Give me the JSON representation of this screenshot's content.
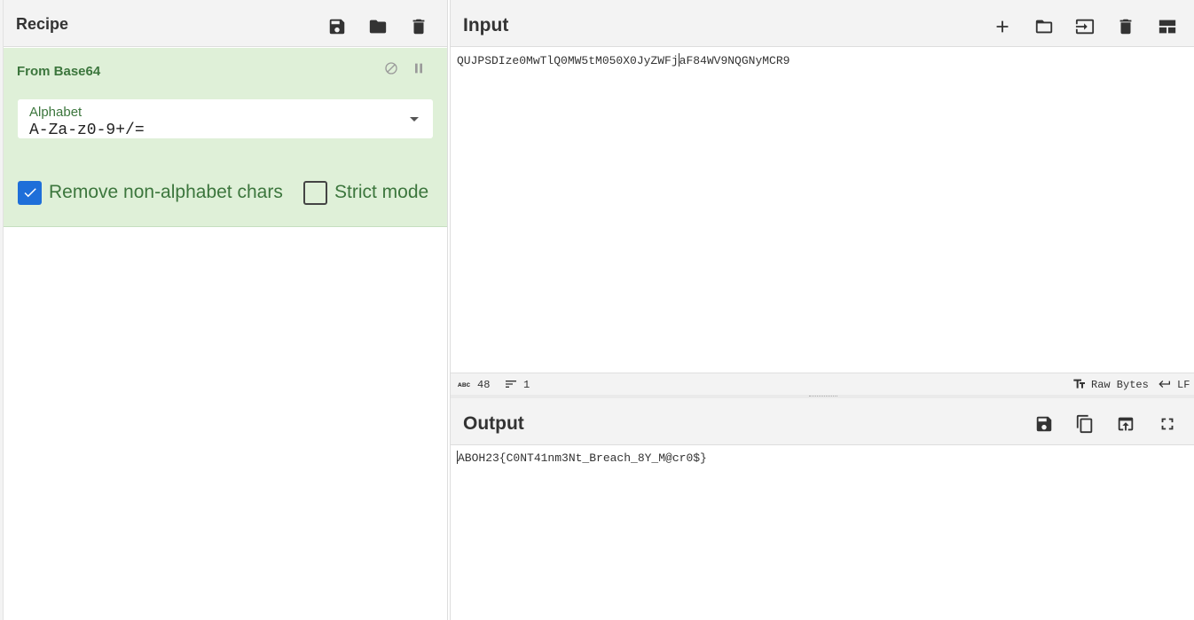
{
  "recipe": {
    "title": "Recipe",
    "operation": {
      "name": "From Base64",
      "alphabet_label": "Alphabet",
      "alphabet_value": "A-Za-z0-9+/=",
      "remove_non_alphabet_label": "Remove non-alphabet chars",
      "remove_non_alphabet_checked": true,
      "strict_mode_label": "Strict mode",
      "strict_mode_checked": false
    }
  },
  "input": {
    "title": "Input",
    "text_before_cursor": "QUJPSDIze0MwTlQ0MW5tM050X0JyZWFj",
    "text_after_cursor": "aF84WV9NQGNyMCR9",
    "stats": {
      "chars_icon": "abc-icon",
      "length": "48",
      "lines": "1",
      "encoding": "Raw Bytes",
      "eol": "LF"
    }
  },
  "output": {
    "title": "Output",
    "text": "ABOH23{C0NT41nm3Nt_Breach_8Y_M@cr0$}"
  },
  "colors": {
    "accent": "#1e6fd9",
    "op_bg": "#dff0d8",
    "op_text": "#3c763d"
  }
}
